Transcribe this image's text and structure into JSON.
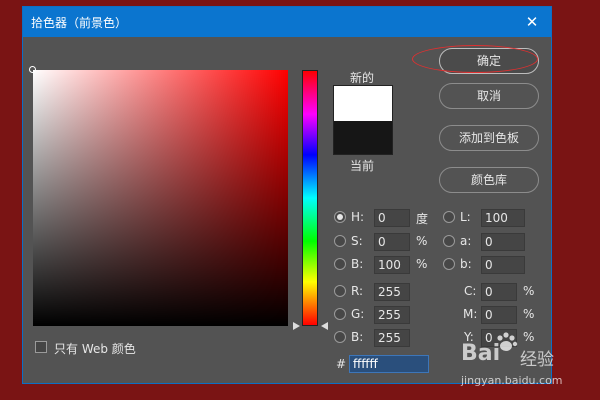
{
  "dialog": {
    "title": "拾色器（前景色）",
    "close_glyph": "✕"
  },
  "swatches": {
    "new_label": "新的",
    "current_label": "当前",
    "new_color": "#ffffff",
    "current_color": "#161616"
  },
  "buttons": {
    "ok": "确定",
    "cancel": "取消",
    "add_to_swatches": "添加到色板",
    "color_libraries": "颜色库"
  },
  "hsb": {
    "h": {
      "label": "H:",
      "value": "0",
      "unit": "度",
      "selected": true
    },
    "s": {
      "label": "S:",
      "value": "0",
      "unit": "%",
      "selected": false
    },
    "b": {
      "label": "B:",
      "value": "100",
      "unit": "%",
      "selected": false
    }
  },
  "lab": {
    "l": {
      "label": "L:",
      "value": "100"
    },
    "a": {
      "label": "a:",
      "value": "0"
    },
    "b": {
      "label": "b:",
      "value": "0"
    }
  },
  "rgb": {
    "r": {
      "label": "R:",
      "value": "255"
    },
    "g": {
      "label": "G:",
      "value": "255"
    },
    "b": {
      "label": "B:",
      "value": "255"
    }
  },
  "cmyk": {
    "c": {
      "label": "C:",
      "value": "0",
      "unit": "%"
    },
    "m": {
      "label": "M:",
      "value": "0",
      "unit": "%"
    },
    "y": {
      "label": "Y:",
      "value": "0",
      "unit": "%"
    }
  },
  "hex": {
    "label": "#",
    "value": "ffffff"
  },
  "web_only": {
    "label": "只有 Web 颜色",
    "checked": false
  },
  "watermark": {
    "brand": "Bai",
    "brand_tail": "经验",
    "url": "jingyan.baidu.com"
  },
  "colors": {
    "background": "#7a1414",
    "dialog": "#535353",
    "titlebar": "#0b75cf",
    "hue_top": "#ff0000",
    "highlight_circle": "#e03030"
  }
}
